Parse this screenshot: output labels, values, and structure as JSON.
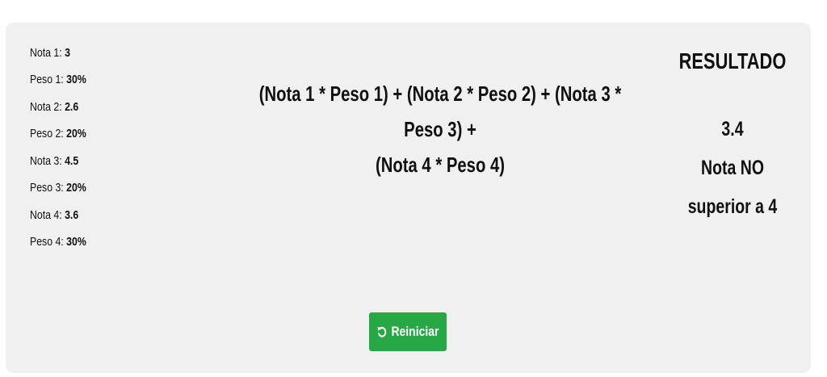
{
  "grades": [
    {
      "nota_label": "Nota 1:",
      "nota_value": "3",
      "peso_label": "Peso 1:",
      "peso_value": "30%"
    },
    {
      "nota_label": "Nota 2:",
      "nota_value": "2.6",
      "peso_label": "Peso 2:",
      "peso_value": "20%"
    },
    {
      "nota_label": "Nota 3:",
      "nota_value": "4.5",
      "peso_label": "Peso 3:",
      "peso_value": "20%"
    },
    {
      "nota_label": "Nota 4:",
      "nota_value": "3.6",
      "peso_label": "Peso 4:",
      "peso_value": "30%"
    }
  ],
  "formula": {
    "line1": "(Nota 1 * Peso 1) + (Nota 2 * Peso 2) + (Nota 3 * Peso 3) +",
    "line2": "(Nota 4 * Peso 4)"
  },
  "result": {
    "title": "RESULTADO",
    "value": "3.4",
    "message_line1": "Nota NO",
    "message_line2": "superior a 4"
  },
  "reset_button": {
    "label": "Reiniciar",
    "icon": "rotate-left-icon",
    "color": "#28a745"
  },
  "colors": {
    "panel_background": "#f0f0f0",
    "text": "#111111"
  }
}
